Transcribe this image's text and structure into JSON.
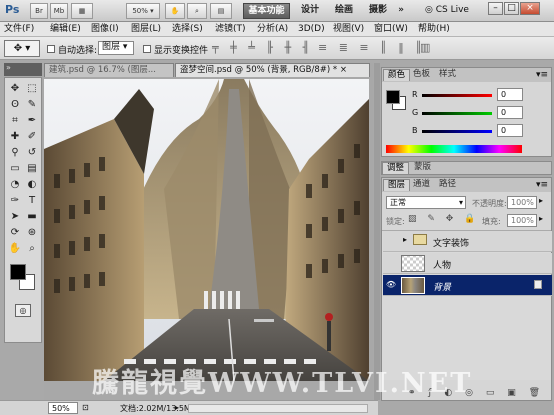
{
  "title_bar": {
    "logo": "Ps",
    "br": "Br",
    "mb": "Mb",
    "zoom": "50%",
    "workspaces": [
      "基本功能",
      "设计",
      "绘画",
      "摄影"
    ],
    "more": "»",
    "cs_live": "CS Live",
    "win_min": "–",
    "win_restore": "□",
    "win_close": "×"
  },
  "menubar": {
    "items": [
      "文件(F)",
      "编辑(E)",
      "图像(I)",
      "图层(L)",
      "选择(S)",
      "滤镜(T)",
      "分析(A)",
      "3D(D)",
      "视图(V)",
      "窗口(W)",
      "帮助(H)"
    ]
  },
  "options": {
    "auto_select_label": "自动选择:",
    "auto_select_value": "图层",
    "show_transform_label": "显示变换控件"
  },
  "document": {
    "tabs": [
      {
        "label": "建筑.psd @ 16.7% (图层..."
      },
      {
        "label": "盗梦空间.psd @ 50% (背景, RGB/8#) *"
      }
    ],
    "tab_close": "×",
    "status_zoom": "50%",
    "status_doc": "文档:2.02M/13.5M",
    "watermark": "騰龍視覺WWW.TLVI.NET"
  },
  "color_panel": {
    "tabs": [
      "颜色",
      "色板",
      "样式"
    ],
    "channels": [
      {
        "name": "R",
        "value": "0"
      },
      {
        "name": "G",
        "value": "0"
      },
      {
        "name": "B",
        "value": "0"
      }
    ]
  },
  "adjust_panel": {
    "tabs": [
      "调整",
      "蒙版"
    ]
  },
  "layers_panel": {
    "tabs": [
      "图层",
      "通道",
      "路径"
    ],
    "blend_mode": "正常",
    "opacity_label": "不透明度:",
    "opacity_value": "100%",
    "lock_label": "锁定:",
    "fill_label": "填充:",
    "fill_value": "100%",
    "layers": [
      {
        "name": "文字装饰",
        "type": "group",
        "visible": false,
        "selected": false
      },
      {
        "name": "人物",
        "type": "layer",
        "visible": false,
        "selected": false
      },
      {
        "name": "背景",
        "type": "layer",
        "visible": true,
        "selected": true
      }
    ]
  },
  "colors": {
    "accent_selected": "#0a246a",
    "foreground": "#000000",
    "background": "#ffffff"
  }
}
